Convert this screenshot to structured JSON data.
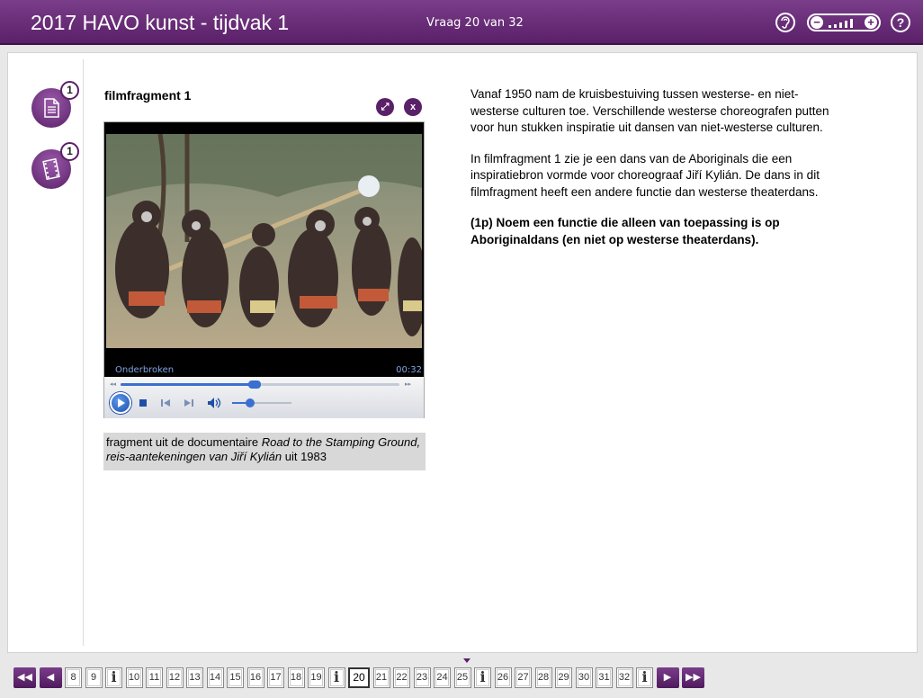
{
  "header": {
    "title": "2017 HAVO kunst - tijdvak 1",
    "question_counter": "Vraag 20 van 32",
    "ear_icon": "?",
    "help_icon": "?",
    "zoom_minus": "−",
    "zoom_plus": "+"
  },
  "sidebar": {
    "document_badge": "1",
    "film_badge": "1"
  },
  "source": {
    "title": "filmfragment 1",
    "expand_label": "⤢",
    "close_label": "x",
    "player": {
      "status": "Onderbroken",
      "time": "00:32",
      "progress": 0.48,
      "volume": 0.3
    },
    "caption_prefix": "fragment uit de documentaire ",
    "caption_italic": "Road to the Stamping Ground, reis-aantekeningen van Jiří Kylián",
    "caption_suffix": " uit 1983"
  },
  "question": {
    "paragraph1": "Vanaf 1950 nam de kruisbestuiving tussen westerse- en niet-westerse culturen toe. Verschillende westerse choreografen putten voor hun stukken inspiratie uit dansen van niet-westerse culturen.",
    "paragraph2": "In filmfragment 1 zie je een dans van de Aboriginals die een inspiratiebron vormde voor choreograaf Jiří Kylián. De dans in dit filmfragment heeft een andere functie dan westerse theaterdans.",
    "prompt": "(1p) Noem een functie die alleen van toepassing is op Aboriginaldans (en niet op westerse theaterdans)."
  },
  "nav": {
    "first": "◀◀",
    "prev": "◀",
    "next": "▶",
    "last": "▶▶",
    "pages": [
      "8",
      "9",
      "i",
      "10",
      "11",
      "12",
      "13",
      "14",
      "15",
      "16",
      "17",
      "18",
      "19",
      "i",
      "20",
      "21",
      "22",
      "23",
      "24",
      "25",
      "i",
      "26",
      "27",
      "28",
      "29",
      "30",
      "31",
      "32",
      "i"
    ],
    "current": "20"
  },
  "colors": {
    "brand": "#5a2068",
    "accent": "#3b6fd0"
  }
}
